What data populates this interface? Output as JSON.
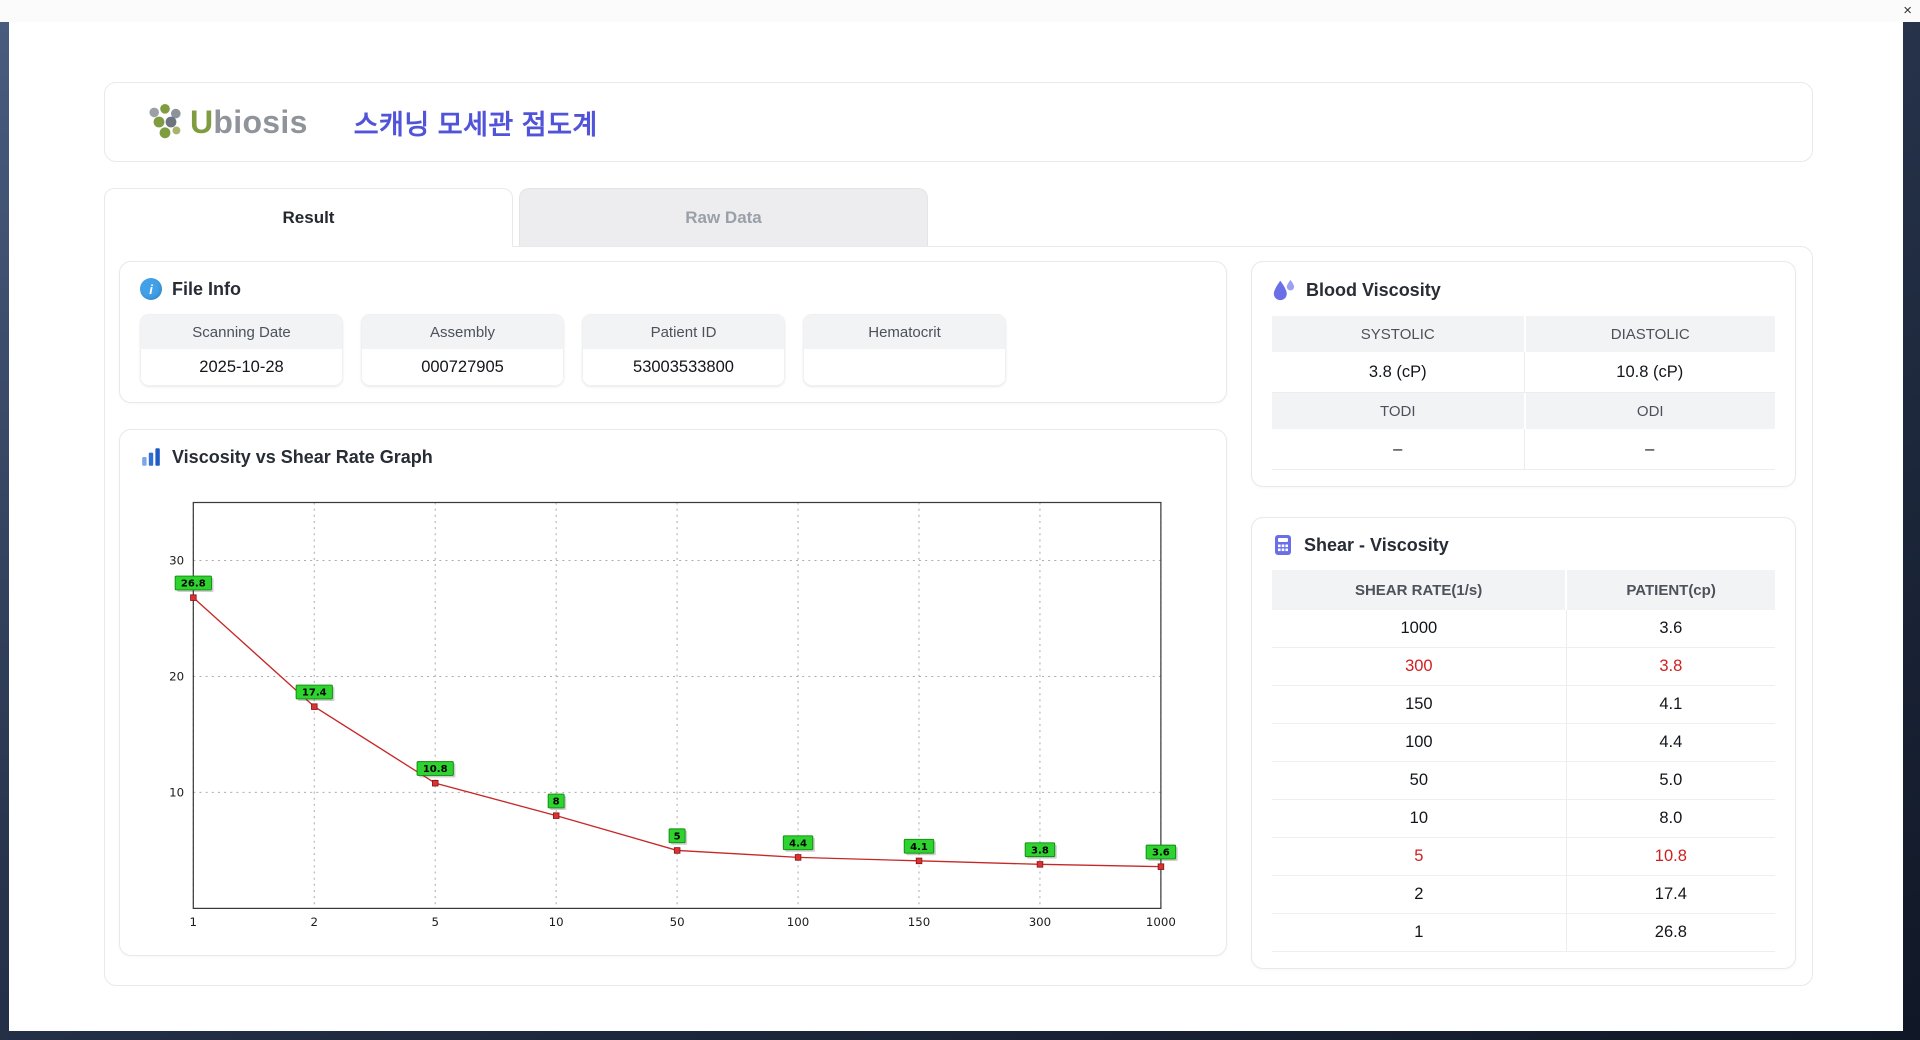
{
  "window": {
    "close_glyph": "×"
  },
  "header": {
    "logo_u": "U",
    "logo_rest": "biosis",
    "title": "스캐닝 모세관 점도계"
  },
  "tabs": [
    {
      "label": "Result",
      "active": true
    },
    {
      "label": "Raw Data",
      "active": false
    }
  ],
  "file_info": {
    "title": "File Info",
    "fields": [
      {
        "label": "Scanning Date",
        "value": "2025-10-28"
      },
      {
        "label": "Assembly",
        "value": "000727905"
      },
      {
        "label": "Patient ID",
        "value": "53003533800"
      },
      {
        "label": "Hematocrit",
        "value": ""
      }
    ]
  },
  "graph": {
    "title": "Viscosity vs Shear Rate Graph"
  },
  "blood_viscosity": {
    "title": "Blood Viscosity",
    "rows": [
      {
        "type": "header",
        "cells": [
          "SYSTOLIC",
          "DIASTOLIC"
        ]
      },
      {
        "type": "value",
        "cells": [
          "3.8 (cP)",
          "10.8 (cP)"
        ]
      },
      {
        "type": "header",
        "cells": [
          "TODI",
          "ODI"
        ]
      },
      {
        "type": "value",
        "cells": [
          "–",
          "–"
        ]
      }
    ]
  },
  "shear_viscosity": {
    "title": "Shear - Viscosity",
    "columns": [
      "SHEAR RATE(1/s)",
      "PATIENT(cp)"
    ],
    "rows": [
      {
        "cells": [
          "1000",
          "3.6"
        ],
        "highlight": false
      },
      {
        "cells": [
          "300",
          "3.8"
        ],
        "highlight": true
      },
      {
        "cells": [
          "150",
          "4.1"
        ],
        "highlight": false
      },
      {
        "cells": [
          "100",
          "4.4"
        ],
        "highlight": false
      },
      {
        "cells": [
          "50",
          "5.0"
        ],
        "highlight": false
      },
      {
        "cells": [
          "10",
          "8.0"
        ],
        "highlight": false
      },
      {
        "cells": [
          "5",
          "10.8"
        ],
        "highlight": true
      },
      {
        "cells": [
          "2",
          "17.4"
        ],
        "highlight": false
      },
      {
        "cells": [
          "1",
          "26.8"
        ],
        "highlight": false
      }
    ]
  },
  "chart_data": {
    "type": "line",
    "title": "Viscosity vs Shear Rate Graph",
    "categories": [
      "1",
      "2",
      "5",
      "10",
      "50",
      "100",
      "150",
      "300",
      "1000"
    ],
    "values": [
      26.8,
      17.4,
      10.8,
      8,
      5,
      4.4,
      4.1,
      3.8,
      3.6
    ],
    "labels": [
      "26.8",
      "17.4",
      "10.8",
      "8",
      "5",
      "4.4",
      "4.1",
      "3.8",
      "3.6"
    ],
    "xlabel": "",
    "ylabel": "",
    "yticks": [
      10,
      20,
      30
    ],
    "ylim": [
      0,
      35
    ],
    "grid": "dashed",
    "legend": "none",
    "line_color": "#c62828",
    "marker_color": "#e03131",
    "label_bg": "#2fd32f"
  },
  "colors": {
    "accent_title": "#5154d8",
    "highlight_red": "#d02020",
    "header_gray": "#f2f3f5",
    "card_border": "#e9e9ec",
    "icon_blue": "#42a0e8",
    "icon_purple": "#6a6fe8",
    "logo_green": "#7f9c40",
    "logo_gray": "#8f949b"
  }
}
